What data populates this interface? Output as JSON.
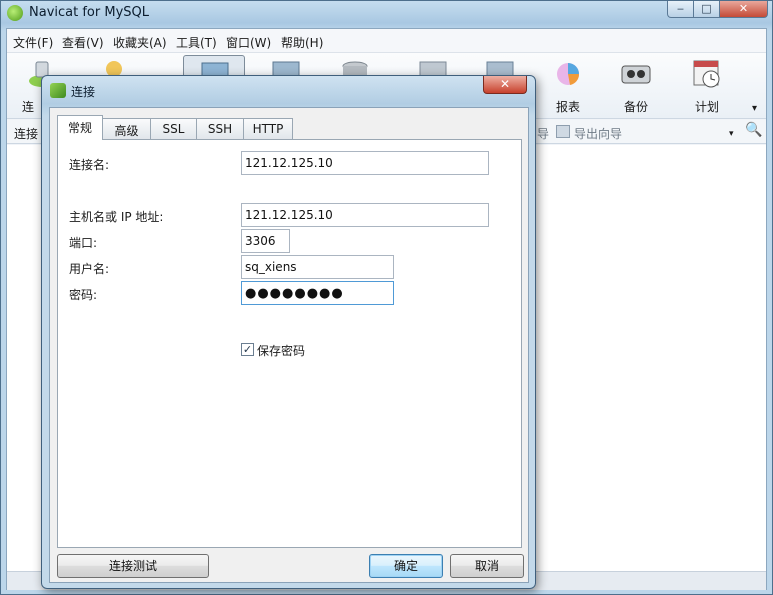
{
  "window": {
    "title": "Navicat for MySQL",
    "minimize_glyph": "‒",
    "maximize_glyph": "□",
    "close_glyph": "✕"
  },
  "menu": {
    "items": [
      "文件(F)",
      "查看(V)",
      "收藏夹(A)",
      "工具(T)",
      "窗口(W)",
      "帮助(H)"
    ]
  },
  "toolbar": {
    "connect_label_partial": "连",
    "visible_labels": {
      "report": "报表",
      "backup": "备份",
      "schedule": "计划"
    },
    "more_glyph": "▾"
  },
  "subtoolbar": {
    "left_label_partial": "连接",
    "import_partial": "导",
    "export_wizard": "导出向导",
    "search_glyph": "🔍",
    "dropdown_glyph": "▾"
  },
  "dialog": {
    "title": "连接",
    "close_glyph": "✕",
    "tabs": [
      "常规",
      "高级",
      "SSL",
      "SSH",
      "HTTP"
    ],
    "active_tab": "常规",
    "fields": {
      "connection_name": {
        "label": "连接名:",
        "value": "121.12.125.10"
      },
      "host": {
        "label": "主机名或 IP 地址:",
        "value": "121.12.125.10"
      },
      "port": {
        "label": "端口:",
        "value": "3306"
      },
      "username": {
        "label": "用户名:",
        "value": "sq_xiens"
      },
      "password": {
        "label": "密码:",
        "value": "●●●●●●●●"
      }
    },
    "save_password": {
      "label": "保存密码",
      "checked": true,
      "check_glyph": "✓"
    },
    "buttons": {
      "test": "连接测试",
      "ok": "确定",
      "cancel": "取消"
    }
  },
  "colors": {
    "accent_blue": "#4f9ad6",
    "close_red": "#c7412c",
    "dialog_frame": "#b1cde3"
  }
}
